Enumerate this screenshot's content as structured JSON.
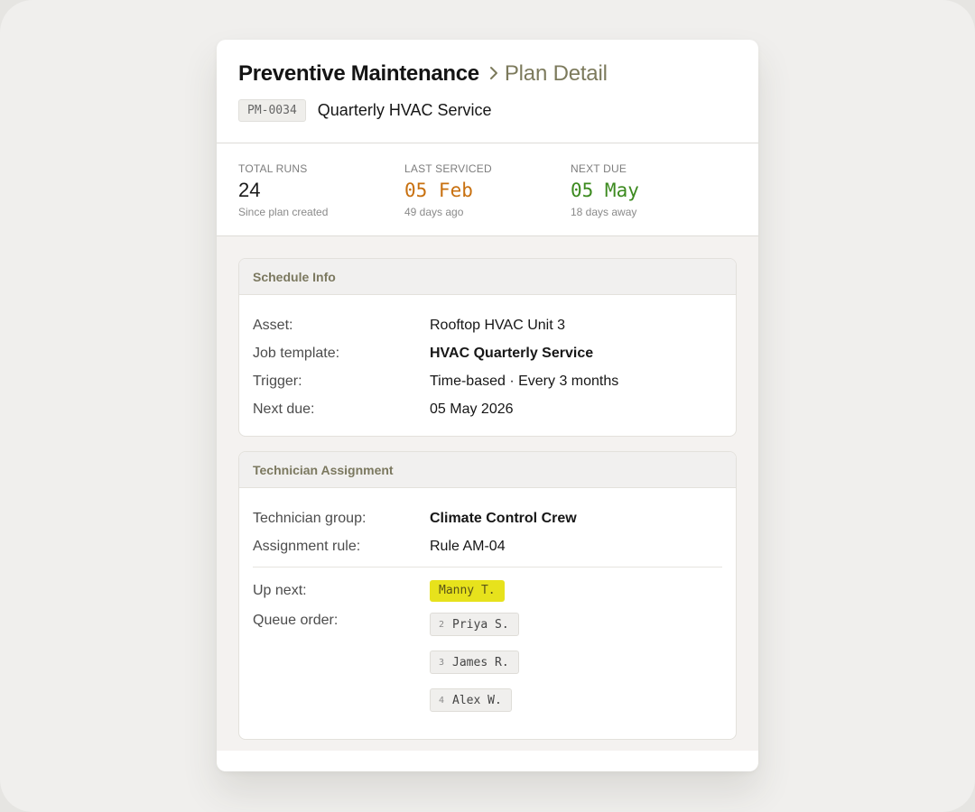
{
  "header": {
    "title": "Preventive Maintenance",
    "subtitle": "Plan Detail",
    "plan_code": "PM-0034",
    "plan_name": "Quarterly HVAC Service"
  },
  "stats": [
    {
      "label": "TOTAL RUNS",
      "value": "24",
      "note": "Since plan created",
      "color": "#1a1a1a"
    },
    {
      "label": "LAST SERVICED",
      "value": "05 Feb",
      "note": "49 days ago",
      "color": "#c8700f"
    },
    {
      "label": "NEXT DUE",
      "value": "05 May",
      "note": "18 days away",
      "color": "#3c8a1f"
    }
  ],
  "schedule": {
    "heading": "Schedule Info",
    "rows": [
      {
        "label": "Asset:",
        "value": "Rooftop HVAC Unit 3"
      },
      {
        "label": "Job template:",
        "value": "HVAC Quarterly Service"
      },
      {
        "label": "Trigger:",
        "value": "Time-based · Every 3 months"
      },
      {
        "label": "Next due:",
        "value": "05 May 2026"
      }
    ]
  },
  "assignment": {
    "heading": "Technician Assignment",
    "rows": [
      {
        "label": "Technician group:",
        "value": "Climate Control Crew"
      },
      {
        "label": "Assignment rule:",
        "value": "Rule AM-04"
      }
    ],
    "up_next_label": "Up next:",
    "up_next": "Manny T.",
    "queue_label": "Queue order:",
    "queue": [
      {
        "num": "2",
        "name": "Priya S."
      },
      {
        "num": "3",
        "name": "James R."
      },
      {
        "num": "4",
        "name": "Alex W."
      }
    ]
  },
  "colors": {
    "accent_olive": "#7b785f",
    "highlight_yellow": "#e7e21c",
    "warn_orange": "#c8700f",
    "ok_green": "#3c8a1f"
  }
}
